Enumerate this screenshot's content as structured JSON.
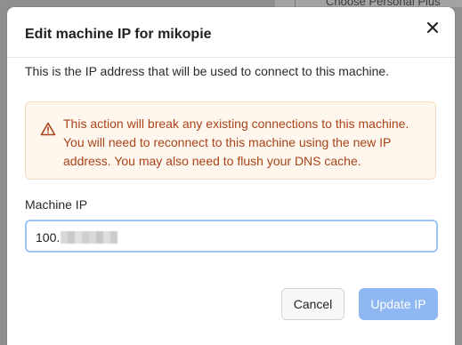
{
  "background": {
    "partial_text": "Choose Personal Plus"
  },
  "dialog": {
    "title": "Edit machine IP for mikopie",
    "close_icon": "close-icon",
    "description": "This is the IP address that will be used to connect to this machine.",
    "warning": {
      "icon": "warning-triangle-icon",
      "text": "This action will break any existing connections to this machine. You will need to reconnect to this machine using the new IP address. You may also need to flush your DNS cache.",
      "color": "#a8431a",
      "background": "#fff7ed"
    },
    "field": {
      "label": "Machine IP",
      "value_visible": "100.",
      "value_redacted": true
    },
    "buttons": {
      "cancel": "Cancel",
      "update": "Update IP",
      "update_disabled": true
    },
    "accent_color": "#8fb8f2"
  }
}
